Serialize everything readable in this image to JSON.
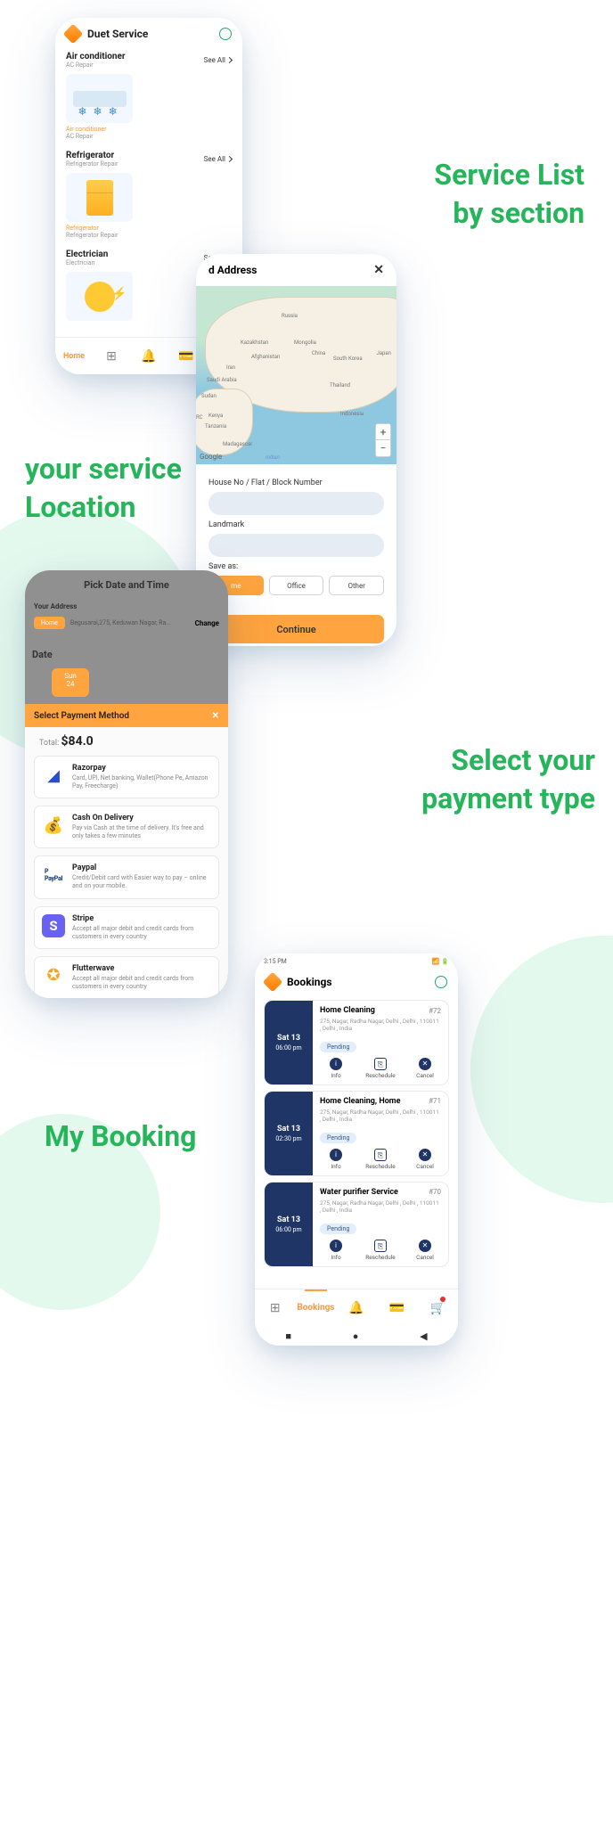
{
  "annotations": {
    "a1": "Service List",
    "a1b": "by section",
    "a2": "your service",
    "a2b": "Location",
    "a3": "Select your",
    "a3b": "payment type",
    "a4": "My Booking"
  },
  "d1": {
    "title": "Duet Service",
    "sections": [
      {
        "title": "Air conditioner",
        "sub": "AC Repair",
        "see": "See All",
        "card_name": "Air conditioner",
        "card_sub": "AC Repair"
      },
      {
        "title": "Refrigerator",
        "sub": "Refrigerator Repair",
        "see": "See All",
        "card_name": "Refrigerator",
        "card_sub": "Refrigerator Repair"
      },
      {
        "title": "Electrician",
        "sub": "Electrician",
        "see": "See All"
      }
    ],
    "nav": {
      "home": "Home"
    }
  },
  "d2": {
    "title": "d Address",
    "google": "Google",
    "indian": "Indian",
    "labels": {
      "russia": "Russia",
      "kazakhstan": "Kazakhstan",
      "mongolia": "Mongolia",
      "iran": "Iran",
      "afghanistan": "Afghanistan",
      "china": "China",
      "saudi": "Saudi Arabia",
      "sudan": "Sudan",
      "drc": "DRC",
      "kenya": "Kenya",
      "tanzania": "Tanzania",
      "madagascar": "Madagascar",
      "thailand": "Thailand",
      "indonesia": "Indonesia",
      "japan": "Japan",
      "southkorea": "South Korea"
    },
    "house": "House No / Flat / Block Number",
    "landmark": "Landmark",
    "saveas": "Save as:",
    "home": "me",
    "office": "Office",
    "other": "Other",
    "continue": "Continue"
  },
  "d3": {
    "header": "Pick Date and Time",
    "addr_label": "Your Address",
    "chip": "Home",
    "addr": "Begusarai,275, Keduwan Nagar, Ra...",
    "change": "Change",
    "date": "Date",
    "sun": "Sun",
    "day": "24",
    "sheet_title": "Select Payment Method",
    "close": "✕",
    "total_label": "Total:",
    "total": "$84.0",
    "methods": [
      {
        "title": "Razorpay",
        "desc": "Card, UPI, Net banking, Wallet(Phone Pe, Amazon Pay, Freecharge)"
      },
      {
        "title": "Cash On Delivery",
        "desc": "Pay via Cash at the time of delivery. It's free and only takes a few minutes"
      },
      {
        "title": "Paypal",
        "desc": "Credit/Debit card with Easier way to pay – online and on your mobile."
      },
      {
        "title": "Stripe",
        "desc": "Accept all major debit and credit cards from customers in every country"
      },
      {
        "title": "Flutterwave",
        "desc": "Accept all major debit and credit cards from customers in every country"
      }
    ]
  },
  "d4": {
    "time": "3:15 PM",
    "title": "Bookings",
    "bookings": [
      {
        "title": "Home Cleaning",
        "id": "#72",
        "addr": "275, Nagar, Radha Nagar, Delhi , Delhi , 110011 , Delhi , India",
        "status": "Pending",
        "day": "Sat 13",
        "time": "06:00 pm"
      },
      {
        "title": "Home Cleaning, Home",
        "id": "#71",
        "addr": "275, Nagar, Radha Nagar, Delhi , Delhi , 110011 , Delhi , India",
        "status": "Pending",
        "day": "Sat 13",
        "time": "02:30 pm"
      },
      {
        "title": "Water purifier Service",
        "id": "#70",
        "addr": "275, Nagar, Radha Nagar, Delhi , Delhi , 110011 , Delhi , India",
        "status": "Pending",
        "day": "Sat 13",
        "time": "06:00 pm"
      }
    ],
    "act": {
      "info": "Info",
      "reschedule": "Reschedule",
      "cancel": "Cancel"
    },
    "nav": "Bookings"
  }
}
